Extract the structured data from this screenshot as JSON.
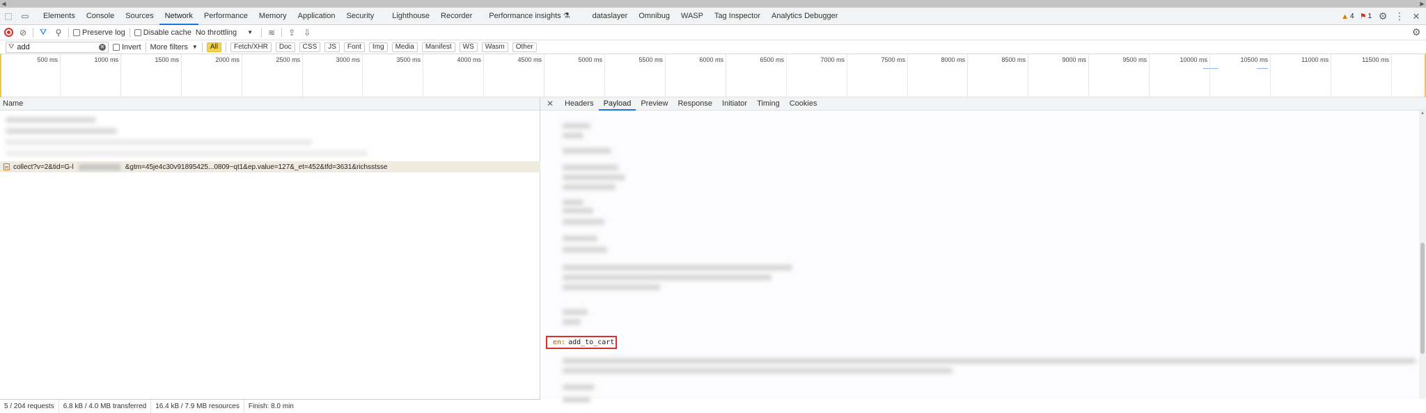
{
  "devtools": {
    "tabs": [
      "Elements",
      "Console",
      "Sources",
      "Network",
      "Performance",
      "Memory",
      "Application",
      "Security",
      "Lighthouse",
      "Recorder",
      "Performance insights",
      "dataslayer",
      "Omnibug",
      "WASP",
      "Tag Inspector",
      "Analytics Debugger"
    ],
    "active_tab": "Network",
    "warnings_count": "4",
    "errors_count": "1"
  },
  "toolbar": {
    "preserve_log": "Preserve log",
    "disable_cache": "Disable cache",
    "throttling": "No throttling"
  },
  "filter": {
    "value": "add",
    "invert": "Invert",
    "more_filters": "More filters",
    "types": [
      "All",
      "Fetch/XHR",
      "Doc",
      "CSS",
      "JS",
      "Font",
      "Img",
      "Media",
      "Manifest",
      "WS",
      "Wasm",
      "Other"
    ],
    "active_type": "All"
  },
  "timeline": {
    "ticks": [
      "500 ms",
      "1000 ms",
      "1500 ms",
      "2000 ms",
      "2500 ms",
      "3000 ms",
      "3500 ms",
      "4000 ms",
      "4500 ms",
      "5000 ms",
      "5500 ms",
      "6000 ms",
      "6500 ms",
      "7000 ms",
      "7500 ms",
      "8000 ms",
      "8500 ms",
      "9000 ms",
      "9500 ms",
      "10000 ms",
      "10500 ms",
      "11000 ms",
      "11500 ms"
    ]
  },
  "requests": {
    "header": "Name",
    "selected": {
      "prefix": "collect?v=2&tid=G-l",
      "suffix": "&gtm=45je4c30v91895425...0809~qt1&ep.value=127&_et=452&tfd=3631&richsstsse"
    }
  },
  "details": {
    "tabs": [
      "Headers",
      "Payload",
      "Preview",
      "Response",
      "Initiator",
      "Timing",
      "Cookies"
    ],
    "active_tab": "Payload",
    "highlight": {
      "key": "en:",
      "value": "add_to_cart"
    }
  },
  "status": {
    "requests": "5 / 204 requests",
    "transferred": "6.8 kB / 4.0 MB transferred",
    "resources": "16.4 kB / 7.9 MB resources",
    "finish": "Finish: 8.0 min"
  }
}
